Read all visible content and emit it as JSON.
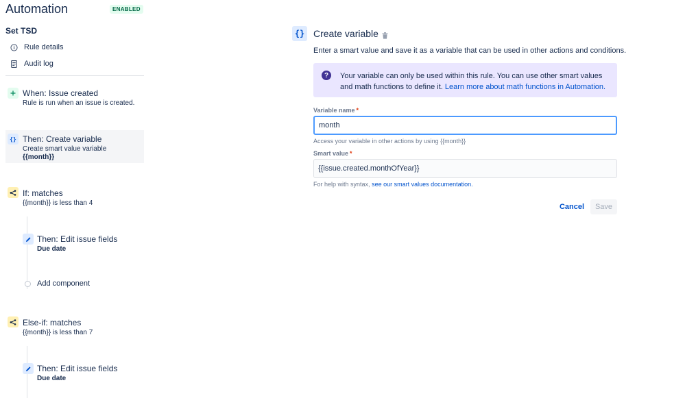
{
  "app": {
    "title": "Automation",
    "status": "ENABLED",
    "rule_name": "Set TSD"
  },
  "sidebar": {
    "links": [
      {
        "label": "Rule details",
        "icon": "info-icon"
      },
      {
        "label": "Audit log",
        "icon": "document-icon"
      }
    ]
  },
  "components": {
    "trigger": {
      "icon": "plus",
      "title": "When: Issue created",
      "sub": "Rule is run when an issue is created."
    },
    "action1": {
      "icon": "{}",
      "title": "Then: Create variable",
      "sub": "Create smart value variable",
      "strong": "{{month}}"
    },
    "cond1": {
      "icon": "branch-icon",
      "title": "If: matches",
      "sub": "{{month}} is less than 4"
    },
    "action2": {
      "icon": "pencil-icon",
      "title": "Then: Edit issue fields",
      "strong": "Due date"
    },
    "add_component": "Add component",
    "cond2": {
      "icon": "branch-icon",
      "title": "Else-if: matches",
      "sub": "{{month}} is less than 7"
    },
    "action3": {
      "icon": "pencil-icon",
      "title": "Then: Edit issue fields",
      "strong": "Due date"
    }
  },
  "panel": {
    "icon": "{}",
    "title": "Create variable",
    "description": "Enter a smart value and save it as a variable that can be used in other actions and conditions.",
    "info_text": "Your variable can only be used within this rule. You can use other smart values and math functions to define it.",
    "info_link": "Learn more about math functions in Automation.",
    "variable_name_label": "Variable name",
    "variable_name_value": "month",
    "variable_name_help": "Access your variable in other actions by using {{month}}",
    "smart_value_label": "Smart value",
    "smart_value_value": "{{issue.created.monthOfYear}}",
    "smart_value_help_prefix": "For help with syntax,",
    "smart_value_help_link": "see our smart values documentation.",
    "required_marker": "*",
    "cancel_label": "Cancel",
    "save_label": "Save"
  },
  "colors": {
    "accent": "#0052cc",
    "enabled_bg": "#e3fcef",
    "enabled_text": "#006644",
    "info_bg": "#eae6ff",
    "focus_border": "#4c9aff"
  }
}
